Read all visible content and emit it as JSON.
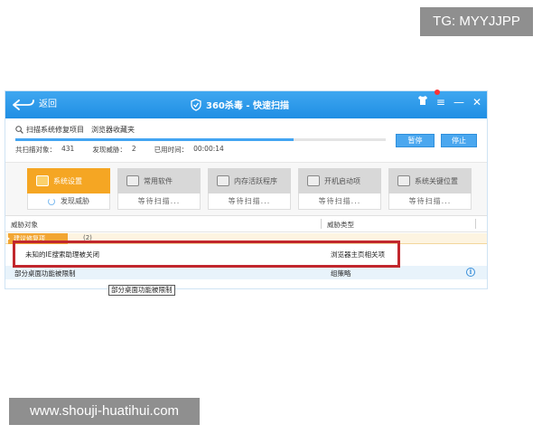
{
  "watermarks": {
    "top": "TG: MYYJJPP",
    "bottom": "www.shouji-huatihui.com"
  },
  "window": {
    "back_label": "返回",
    "title": "360杀毒 - 快速扫描",
    "icons": {
      "back": "back-arrow-icon",
      "shield": "shield-check-icon",
      "skin": "tshirt-icon",
      "menu": "menu-icon",
      "minimize": "minimize-icon",
      "close": "close-icon"
    },
    "controls": {
      "menu": "≡",
      "minimize": "—",
      "close": "✕"
    }
  },
  "status": {
    "scanning_label": "扫描系统修复项目",
    "scanning_item": "浏览器收藏夹",
    "progress_percent": 75,
    "scanned_label": "共扫描对象：",
    "scanned_value": "431",
    "threats_label": "发现威胁：",
    "threats_value": "2",
    "elapsed_label": "已用时间：",
    "elapsed_value": "00:00:14",
    "pause_button": "暂停",
    "stop_button": "停止"
  },
  "categories": [
    {
      "name": "系统设置",
      "status": "发现威胁",
      "active": true
    },
    {
      "name": "常用软件",
      "status": "等待扫描...",
      "active": false
    },
    {
      "name": "内存活跃程序",
      "status": "等待扫描...",
      "active": false
    },
    {
      "name": "开机启动项",
      "status": "等待扫描...",
      "active": false
    },
    {
      "name": "系统关键位置",
      "status": "等待扫描...",
      "active": false
    }
  ],
  "table": {
    "col_object": "威胁对象",
    "col_type": "威胁类型",
    "group_label": "建议修复项",
    "group_count": "(2)",
    "rows": [
      {
        "object": "未知的IE搜索助理被关闭",
        "type": "浏览器主页相关项"
      },
      {
        "object": "部分桌面功能被限制",
        "type": "组策略"
      }
    ]
  },
  "tooltip": "部分桌面功能被限制",
  "colors": {
    "title_bar": "#2a97ea",
    "active_category": "#f5a623",
    "highlight_box": "#c1272d",
    "button": "#4aa7ef"
  }
}
